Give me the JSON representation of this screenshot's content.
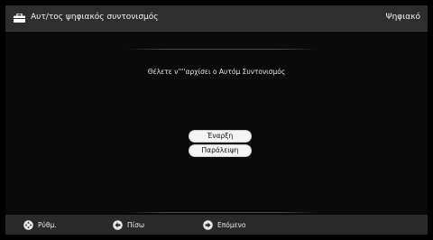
{
  "header": {
    "title": "Αυτ/τος ψηφιακός συντονισμός",
    "mode": "Ψηφιακό",
    "icon": "toolbox-icon"
  },
  "dialog": {
    "prompt": "Θέλετε ν''''αρχίσει ο Αυτόμ Συντονισμός",
    "start_label": "Έναρξη",
    "skip_label": "Παράλειψη"
  },
  "footer": {
    "settings": {
      "label": "Ρύθμ.",
      "icon": "settings-dpad-icon"
    },
    "back": {
      "label": "Πίσω",
      "icon": "arrow-left-circle-icon"
    },
    "next": {
      "label": "Επόμενο",
      "icon": "arrow-right-circle-icon"
    }
  },
  "colors": {
    "background": "#2a2a2a",
    "content": "#0a0a0a",
    "button": "#f4f4f4"
  }
}
